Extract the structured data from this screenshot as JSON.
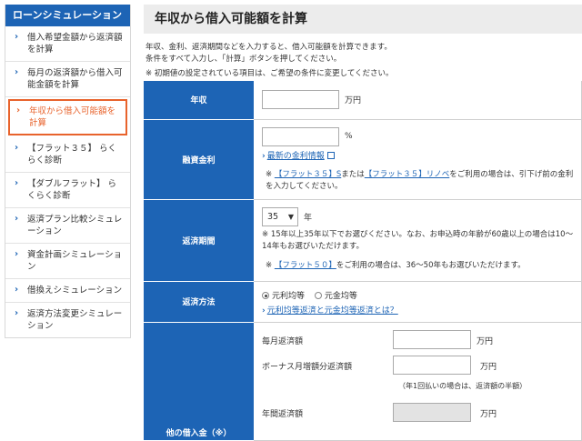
{
  "sidebar": {
    "header": "ローンシミュレーション",
    "items": [
      {
        "label": "借入希望金額から返済額を計算",
        "active": false
      },
      {
        "label": "毎月の返済額から借入可能金額を計算",
        "active": false
      },
      {
        "label": "年収から借入可能額を計算",
        "active": true
      },
      {
        "label": "【フラット３５】 らくらく診断",
        "active": false
      },
      {
        "label": "【ダブルフラット】 らくらく診断",
        "active": false
      },
      {
        "label": "返済プラン比較シミュレーション",
        "active": false
      },
      {
        "label": "資金計画シミュレーション",
        "active": false
      },
      {
        "label": "借換えシミュレーション",
        "active": false
      },
      {
        "label": "返済方法変更シミュレーション",
        "active": false
      }
    ]
  },
  "page": {
    "title": "年収から借入可能額を計算",
    "intro_line1": "年収、金利、返済期間などを入力すると、借入可能額を計算できます。",
    "intro_line2": "条件をすべて入力し、「計算」ボタンを押してください。",
    "intro_note": "※ 初期値の設定されている項目は、ご希望の条件に変更してください。"
  },
  "form": {
    "income": {
      "label": "年収",
      "value": "",
      "unit": "万円"
    },
    "rate": {
      "label": "融資金利",
      "value": "",
      "unit": "%",
      "link": "最新の金利情報",
      "note_prefix": "※",
      "note_link1": "【フラット３５】S",
      "note_mid": "または",
      "note_link2": "【フラット３５】リノベ",
      "note_suffix": "をご利用の場合は、引下げ前の金利を入力してください。"
    },
    "term": {
      "label": "返済期間",
      "selected": "35",
      "unit": "年",
      "note1": "※ 15年以上35年以下でお選びください。なお、お申込時の年齢が60歳以上の場合は10～14年もお選びいただけます。",
      "note2_prefix": "※",
      "note2_link": "【フラット５０】",
      "note2_suffix": "をご利用の場合は、36～50年もお選びいただけます。"
    },
    "method": {
      "label": "返済方法",
      "option1": "元利均等",
      "option2": "元金均等",
      "selected": "option1",
      "link": "元利均等返済と元金均等返済とは？"
    },
    "other_loans": {
      "label": "他の借入金（※）",
      "monthly_label": "毎月返済額",
      "monthly_unit": "万円",
      "bonus_label": "ボーナス月増額分返済額",
      "bonus_unit": "万円",
      "bonus_note": "（年1回払いの場合は、返済額の半額）",
      "annual_label": "年間返済額",
      "annual_unit": "万円"
    }
  },
  "colors": {
    "brand_blue": "#1d64b5",
    "active_orange": "#e8632c",
    "title_bg": "#ececec"
  }
}
